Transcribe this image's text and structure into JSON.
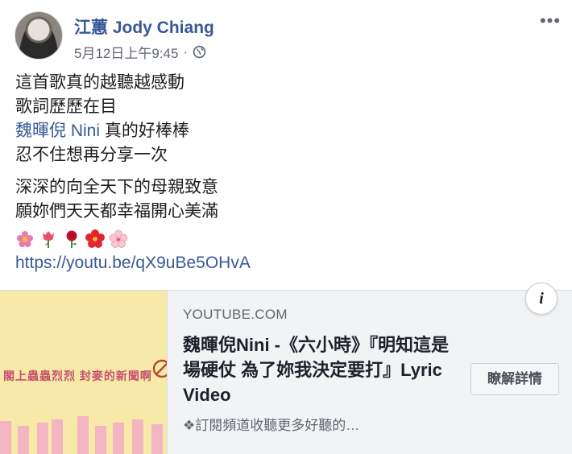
{
  "post": {
    "author": "江蕙 Jody Chiang",
    "timestamp": "5月12日上午9:45",
    "separator": "·",
    "privacy_icon": "globe-icon",
    "more_glyph": "•••",
    "lines": [
      "這首歌真的越聽越感動",
      "歌詞歷歷在目"
    ],
    "mention": "魏暉倪 Nini",
    "mention_suffix": " 真的好棒棒",
    "line_after": "忍不住想再分享一次",
    "lines2": [
      "深深的向全天下的母親致意",
      "願妳們天天都幸福開心美滿"
    ],
    "emojis": [
      "flower-icon",
      "tulip-icon",
      "rose-icon",
      "hibiscus-icon",
      "cherry-blossom-icon"
    ],
    "url": "https://youtu.be/qX9uBe5OHvA"
  },
  "card": {
    "domain": "YOUTUBE.COM",
    "title": "魏暉倪Nini -《六小時》『明知這是場硬仗 為了妳我決定要打』Lyric Video",
    "description": "❖訂閱頻道收聽更多好聽的…",
    "button_label": "瞭解詳情",
    "info_glyph": "i",
    "thumbnail_text": "閣上蟲蟲烈烈 封麥的新聞啊"
  },
  "colors": {
    "link": "#385898",
    "text": "#1c1e21",
    "secondary": "#606770",
    "thumbnail_bg": "#f7e9a8"
  }
}
